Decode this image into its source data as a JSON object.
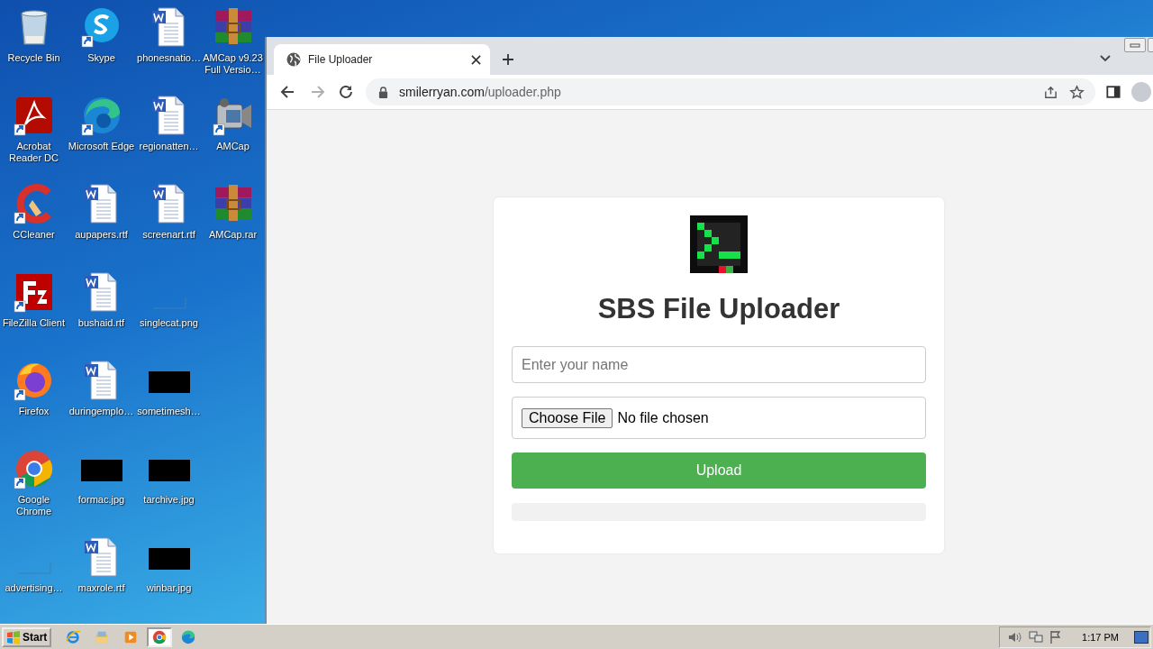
{
  "desktop": {
    "icons": [
      {
        "kind": "recycle",
        "label": "Recycle Bin",
        "shortcut": false
      },
      {
        "kind": "acrobat",
        "label": "Acrobat Reader DC",
        "shortcut": true
      },
      {
        "kind": "ccleaner",
        "label": "CCleaner",
        "shortcut": true
      },
      {
        "kind": "filezilla",
        "label": "FileZilla Client",
        "shortcut": true
      },
      {
        "kind": "firefox",
        "label": "Firefox",
        "shortcut": true
      },
      {
        "kind": "chrome",
        "label": "Google Chrome",
        "shortcut": true
      },
      {
        "kind": "blank",
        "label": "advertising…",
        "shortcut": false
      },
      {
        "kind": "skype",
        "label": "Skype",
        "shortcut": true
      },
      {
        "kind": "edge",
        "label": "Microsoft Edge",
        "shortcut": true
      },
      {
        "kind": "word",
        "label": "aupapers.rtf",
        "shortcut": false
      },
      {
        "kind": "word",
        "label": "bushaid.rtf",
        "shortcut": false
      },
      {
        "kind": "word",
        "label": "duringemplo…",
        "shortcut": false
      },
      {
        "kind": "black",
        "label": "formac.jpg",
        "shortcut": false
      },
      {
        "kind": "word",
        "label": "maxrole.rtf",
        "shortcut": false
      },
      {
        "kind": "word",
        "label": "phonesnatio…",
        "shortcut": false
      },
      {
        "kind": "word",
        "label": "regionatten…",
        "shortcut": false
      },
      {
        "kind": "word",
        "label": "screenart.rtf",
        "shortcut": false
      },
      {
        "kind": "blank",
        "label": "singlecat.png",
        "shortcut": false
      },
      {
        "kind": "black",
        "label": "sometimesh…",
        "shortcut": false
      },
      {
        "kind": "black",
        "label": "tarchive.jpg",
        "shortcut": false
      },
      {
        "kind": "black",
        "label": "winbar.jpg",
        "shortcut": false
      },
      {
        "kind": "winrar",
        "label": "AMCap v9.23 Full Versio…",
        "shortcut": false
      },
      {
        "kind": "amcap",
        "label": "AMCap",
        "shortcut": true
      },
      {
        "kind": "winrar",
        "label": "AMCap.rar",
        "shortcut": false
      }
    ]
  },
  "browser": {
    "tabs": [
      {
        "title": "File Uploader",
        "selected": true
      }
    ],
    "url_host": "smilerryan.com",
    "url_path": "/uploader.php",
    "forward_disabled": true
  },
  "page": {
    "title": "SBS File Uploader",
    "name_placeholder": "Enter your name",
    "file_button": "Choose File",
    "file_status": "No file chosen",
    "upload_button": "Upload",
    "progress": {
      "level": 0
    }
  },
  "taskbar": {
    "start": "Start",
    "apps": [
      {
        "kind": "ie",
        "selected": false
      },
      {
        "kind": "explorer",
        "selected": false
      },
      {
        "kind": "media",
        "selected": false
      },
      {
        "kind": "chrome",
        "selected": true
      },
      {
        "kind": "edge",
        "selected": false
      }
    ],
    "clock": "1:17 PM"
  }
}
